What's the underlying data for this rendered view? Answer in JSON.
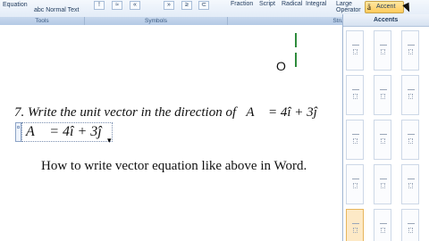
{
  "ribbon": {
    "equation_label": "Equation",
    "normal_text_label": "abc Normal Text",
    "tools_label": "Tools",
    "symbols_label": "Symbols",
    "structures_label": "Structures",
    "fraction_label": "Fraction",
    "script_label": "Script",
    "radical_label": "Radical",
    "integral_label": "Integral",
    "large_operator_label": "Large Operator",
    "accent_label": "Accent",
    "symbol_buttons": [
      "!",
      "≈",
      "«",
      "»",
      "≥",
      "⊂"
    ]
  },
  "document": {
    "o_text": "O",
    "problem_text": "7. Write the unit vector in the direction of",
    "problem_equation": "A⃗ = 4î + 3ĵ",
    "editing_equation": "A⃗  =  4î + 3ĵ",
    "caption": "How to write vector equation like above in Word."
  },
  "gallery": {
    "title": "Accents"
  }
}
